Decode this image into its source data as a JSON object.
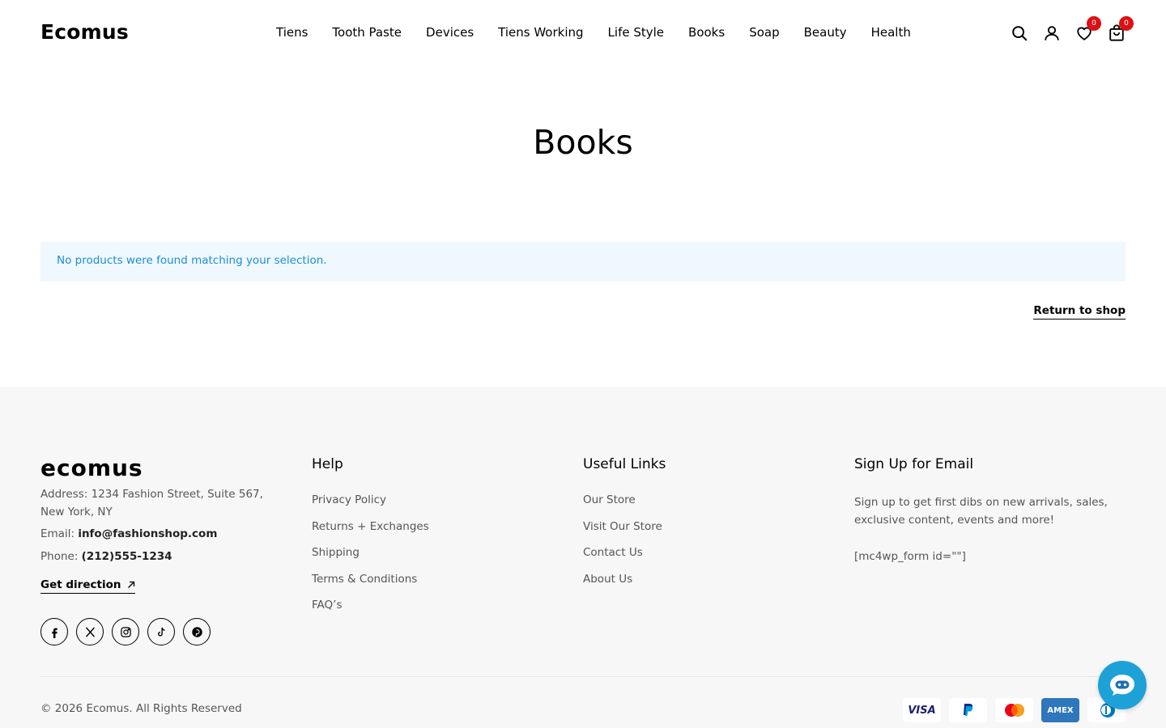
{
  "header": {
    "logo": "Ecomus",
    "nav": [
      "Tiens",
      "Tooth Paste",
      "Devices",
      "Tiens Working",
      "Life Style",
      "Books",
      "Soap",
      "Beauty",
      "Health"
    ],
    "icons": [
      "search-icon",
      "account-icon",
      "wishlist-icon",
      "cart-icon"
    ],
    "wishlist_count": "0",
    "cart_count": "0",
    "badge_color": "#db1215"
  },
  "main": {
    "title": "Books",
    "notice": "No products were found matching your selection.",
    "return_link": "Return to shop",
    "notice_color": "#1c8fd6"
  },
  "footer": {
    "logo": "ecomus",
    "address": "Address: 1234 Fashion Street, Suite 567, New York, NY",
    "email_label": "Email:",
    "email": "info@fashionshop.com",
    "phone_label": "Phone:",
    "phone": "(212)555-1234",
    "direction": "Get direction",
    "socials": [
      "facebook-icon",
      "x-icon",
      "instagram-icon",
      "tiktok-icon",
      "pinterest-icon"
    ],
    "help": {
      "heading": "Help",
      "links": [
        "Privacy Policy",
        "Returns + Exchanges",
        "Shipping",
        "Terms & Conditions",
        "FAQ’s"
      ]
    },
    "useful": {
      "heading": "Useful Links",
      "links": [
        "Our Store",
        "Visit Our Store",
        "Contact Us",
        "About Us"
      ]
    },
    "signup": {
      "heading": "Sign Up for Email",
      "text": "Sign up to get first dibs on new arrivals, sales, exclusive content, events and more!",
      "form": "[mc4wp_form id=\"\"]"
    },
    "copyright": "© 2026 Ecomus. All Rights Reserved",
    "payments": [
      "VISA",
      "PayPal",
      "Mastercard",
      "AMEX",
      "Diners"
    ],
    "chat_color": "#1da1d6"
  }
}
